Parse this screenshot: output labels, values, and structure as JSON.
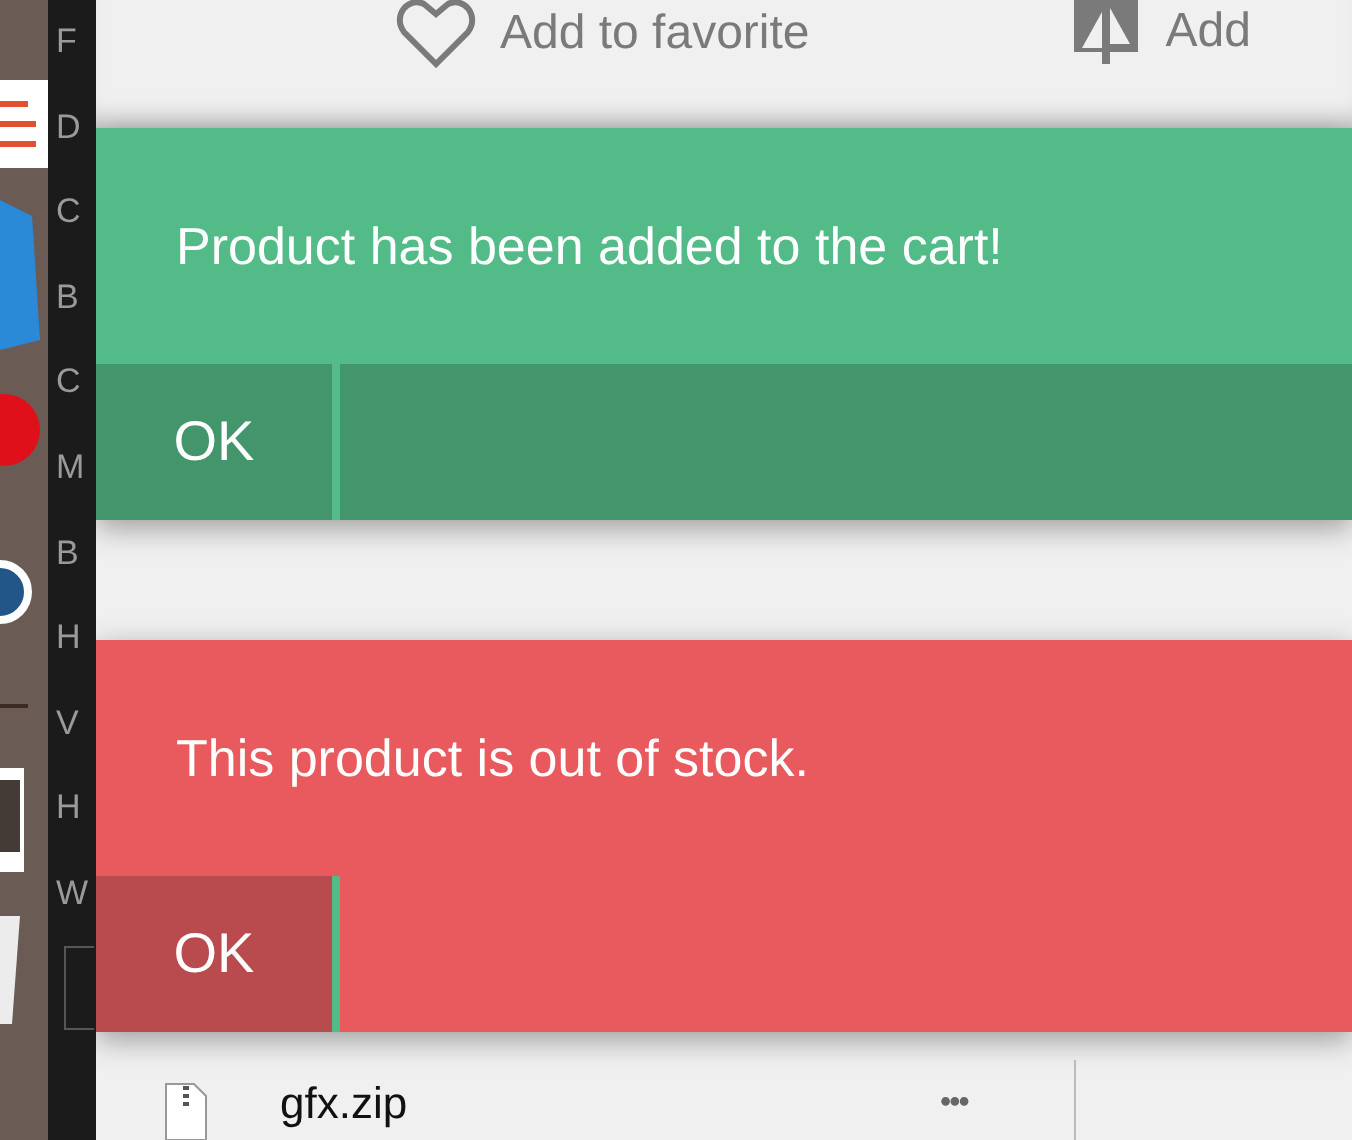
{
  "side_letters": [
    "F",
    "D",
    "C",
    "B",
    "C",
    "M",
    "B",
    "H",
    "V",
    "H",
    "W"
  ],
  "top_actions": [
    {
      "kind": "favorite",
      "label": "Add to favorite"
    },
    {
      "kind": "compare",
      "label": "Add"
    }
  ],
  "toasts": [
    {
      "kind": "success",
      "message": "Product has been added to the cart!",
      "button": "OK"
    },
    {
      "kind": "error",
      "message": "This product is out of stock.",
      "button": "OK"
    }
  ],
  "file": {
    "name": "gfx.zip",
    "menu": "•••"
  }
}
